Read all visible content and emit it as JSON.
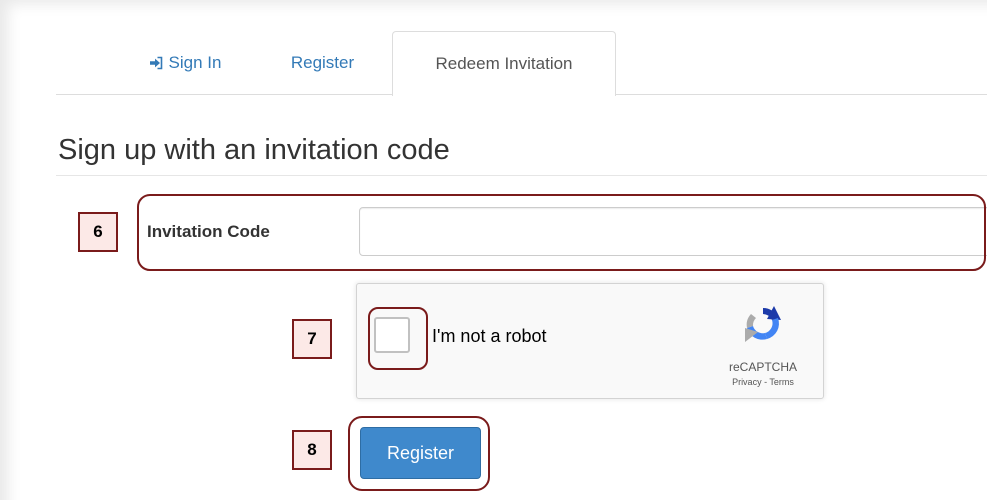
{
  "tabs": [
    {
      "label": "Sign In",
      "icon": "sign-in-icon"
    },
    {
      "label": "Register"
    },
    {
      "label": "Redeem Invitation",
      "active": true
    }
  ],
  "form": {
    "heading": "Sign up with an invitation code",
    "invitation_label": "Invitation Code",
    "invitation_placeholder": "",
    "register_label": "Register"
  },
  "captcha": {
    "label": "I'm not a robot",
    "brand": "reCAPTCHA",
    "privacy": "Privacy",
    "separator": " - ",
    "terms": "Terms"
  },
  "annotations": [
    "6",
    "7",
    "8"
  ],
  "colors": {
    "link": "#337ab7",
    "button": "#3f89cc",
    "highlight": "#7a1b1b",
    "badge_fill": "#fce9e7"
  }
}
